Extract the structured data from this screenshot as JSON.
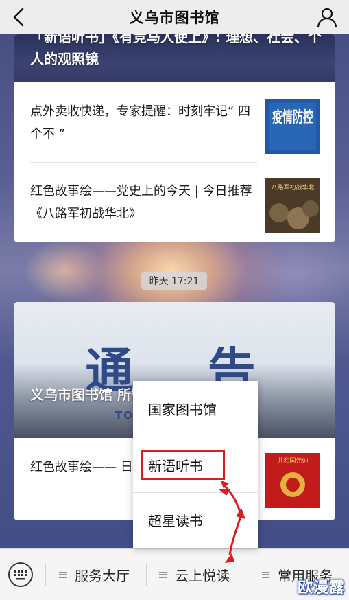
{
  "navbar": {
    "title": "义乌市图书馆",
    "back_icon": "chevron-left-icon",
    "profile_icon": "person-icon"
  },
  "feed": {
    "card1": {
      "cover_title": "「新语听书」《有竞马人使上》: 理想、社会、个人的观照镜",
      "items": [
        {
          "text": "点外卖收快递，专家提醒：时刻牢记“ 四个不 ”",
          "thumb_label": "疫情防控"
        },
        {
          "text": "红色故事绘——党史上的今天 | 今日推荐《八路军初战华北》",
          "thumb_label": "八路军初战华北"
        }
      ]
    },
    "timestamp": "昨天 17:21",
    "card2": {
      "cover_headline": "通  告",
      "cover_sub": "TO",
      "cover_title": "义乌市图书馆                              所暂停开放的通告",
      "items": [
        {
          "text": "红色故事绘——                                  日推荐《陈毅的",
          "thumb_label": "共和国元帅"
        }
      ]
    }
  },
  "popup_menu": {
    "items": [
      {
        "label": "国家图书馆"
      },
      {
        "label": "新语听书",
        "highlighted": true
      },
      {
        "label": "超星读书"
      }
    ]
  },
  "bottom_menu": {
    "keyboard_icon": "keyboard-icon",
    "items": [
      {
        "label": "服务大厅",
        "icon": "hamburger-icon"
      },
      {
        "label": "云上悦读",
        "icon": "hamburger-icon"
      },
      {
        "label": "常用服务",
        "icon": "hamburger-icon"
      }
    ]
  },
  "watermark": "欧漫露",
  "colors": {
    "annotation_red": "#d81e1e",
    "navbar_bg": "#ededed",
    "notice_blue": "#2f4a86"
  }
}
